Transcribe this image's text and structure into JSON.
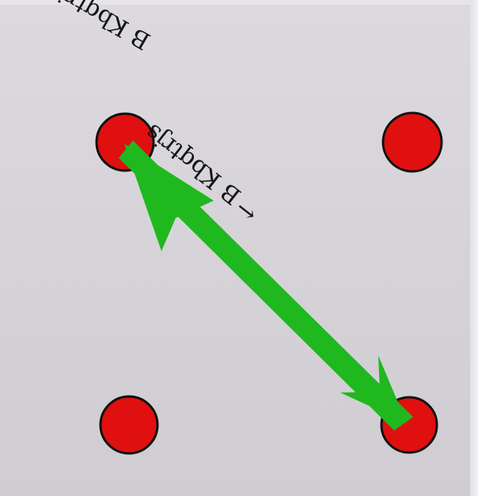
{
  "labels": {
    "upper": "B Kbqtrjs",
    "lower": "B Kbqtrjs",
    "arrow_glyph": "→"
  },
  "colors": {
    "dot_fill": "#e01010",
    "dot_stroke": "#111111",
    "arrow": "#1fb81f",
    "background": "#d8d6db"
  }
}
